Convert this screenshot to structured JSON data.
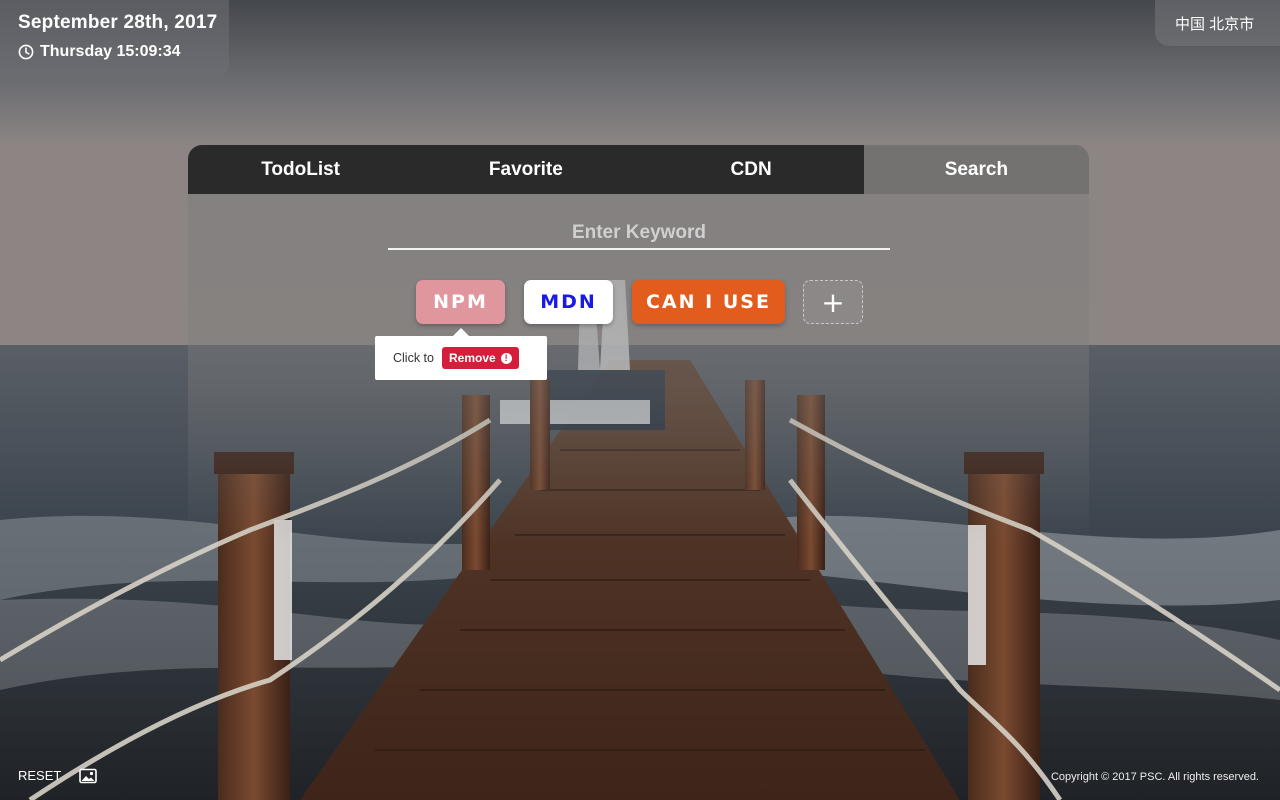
{
  "datetime": {
    "date": "September 28th, 2017",
    "time": "Thursday 15:09:34"
  },
  "location": "中国 北京市",
  "tabs": [
    {
      "label": "TodoList",
      "active": false
    },
    {
      "label": "Favorite",
      "active": false
    },
    {
      "label": "CDN",
      "active": false
    },
    {
      "label": "Search",
      "active": true
    }
  ],
  "search": {
    "placeholder": "Enter Keyword",
    "value": ""
  },
  "engines": [
    {
      "label": "NPM",
      "color": "#e0969d"
    },
    {
      "label": "MDN",
      "color": "#ffffff"
    },
    {
      "label": "CAN I USE",
      "color": "#e25c1e"
    }
  ],
  "add_engine": {
    "label": "+"
  },
  "tooltip": {
    "prefix": "Click to",
    "action": "Remove",
    "action_icon": "!"
  },
  "footer": {
    "reset_label": "RESET",
    "wallpaper_icon": "image-icon",
    "copyright": "Copyright © 2017 PSC. All rights reserved."
  },
  "colors": {
    "accent_remove": "#d41e3c",
    "tab_bar": "#2a2a2a"
  }
}
